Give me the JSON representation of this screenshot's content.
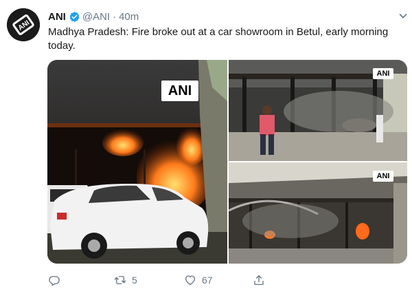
{
  "tweet": {
    "author": {
      "name": "ANI",
      "handle": "@ANI",
      "separator": "·",
      "time": "40m",
      "verified": true,
      "avatar_text": "ANI"
    },
    "text": "Madhya Pradesh: Fire broke out at a car showroom in Betul, early morning today.",
    "media": [
      {
        "watermark": "ANI"
      },
      {
        "watermark": "ANI"
      },
      {
        "watermark": "ANI"
      }
    ],
    "actions": {
      "reply_count": "",
      "retweet_count": "5",
      "like_count": "67"
    }
  },
  "colors": {
    "text": "#14171a",
    "secondary": "#657786",
    "verified": "#1da1f2",
    "fire": "#ff5a1a"
  },
  "icons": [
    "ani-logo-icon",
    "verified-badge-icon",
    "chevron-down-icon",
    "reply-icon",
    "retweet-icon",
    "like-icon",
    "share-icon"
  ]
}
